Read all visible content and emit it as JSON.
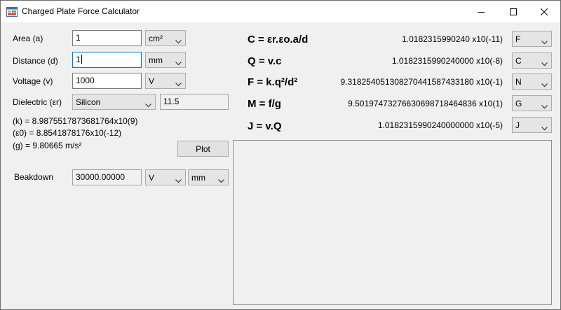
{
  "window": {
    "title": "Charged Plate Force Calculator"
  },
  "inputs": {
    "area": {
      "label": "Area (a)",
      "value": "1",
      "unit": "cm²"
    },
    "distance": {
      "label": "Distance (d)",
      "value": "1",
      "unit": "mm"
    },
    "voltage": {
      "label": "Voltage (v)",
      "value": "1000",
      "unit": "V"
    },
    "dielectric": {
      "label": "Dielectric (εr)",
      "material": "Silicon",
      "value": "11.5"
    }
  },
  "constants": {
    "k": "(k) = 8.9875517873681764x10(9)",
    "e0": "(ε0) = 8.8541878176x10(-12)",
    "g": "(g) = 9.80665 m/s²"
  },
  "plot_button": "Plot",
  "breakdown": {
    "label": "Beakdown",
    "value": "30000.00000",
    "unit_voltage": "V",
    "unit_distance": "mm"
  },
  "results": [
    {
      "formula": "C = εr.εo.a/d",
      "value": "1.0182315990240 x10(-11)",
      "unit": "F"
    },
    {
      "formula": "Q = v.c",
      "value": "1.0182315990240000 x10(-8)",
      "unit": "C"
    },
    {
      "formula": "F = k.q²/d²",
      "value": "9.318254051308270441587433180 x10(-1)",
      "unit": "N"
    },
    {
      "formula": "M = f/g",
      "value": "9.501974732766306987184648​36 x10(1)",
      "unit": "G"
    },
    {
      "formula": "J = v.Q",
      "value": "1.0182315990240000000 x10(-5)",
      "unit": "J"
    }
  ]
}
